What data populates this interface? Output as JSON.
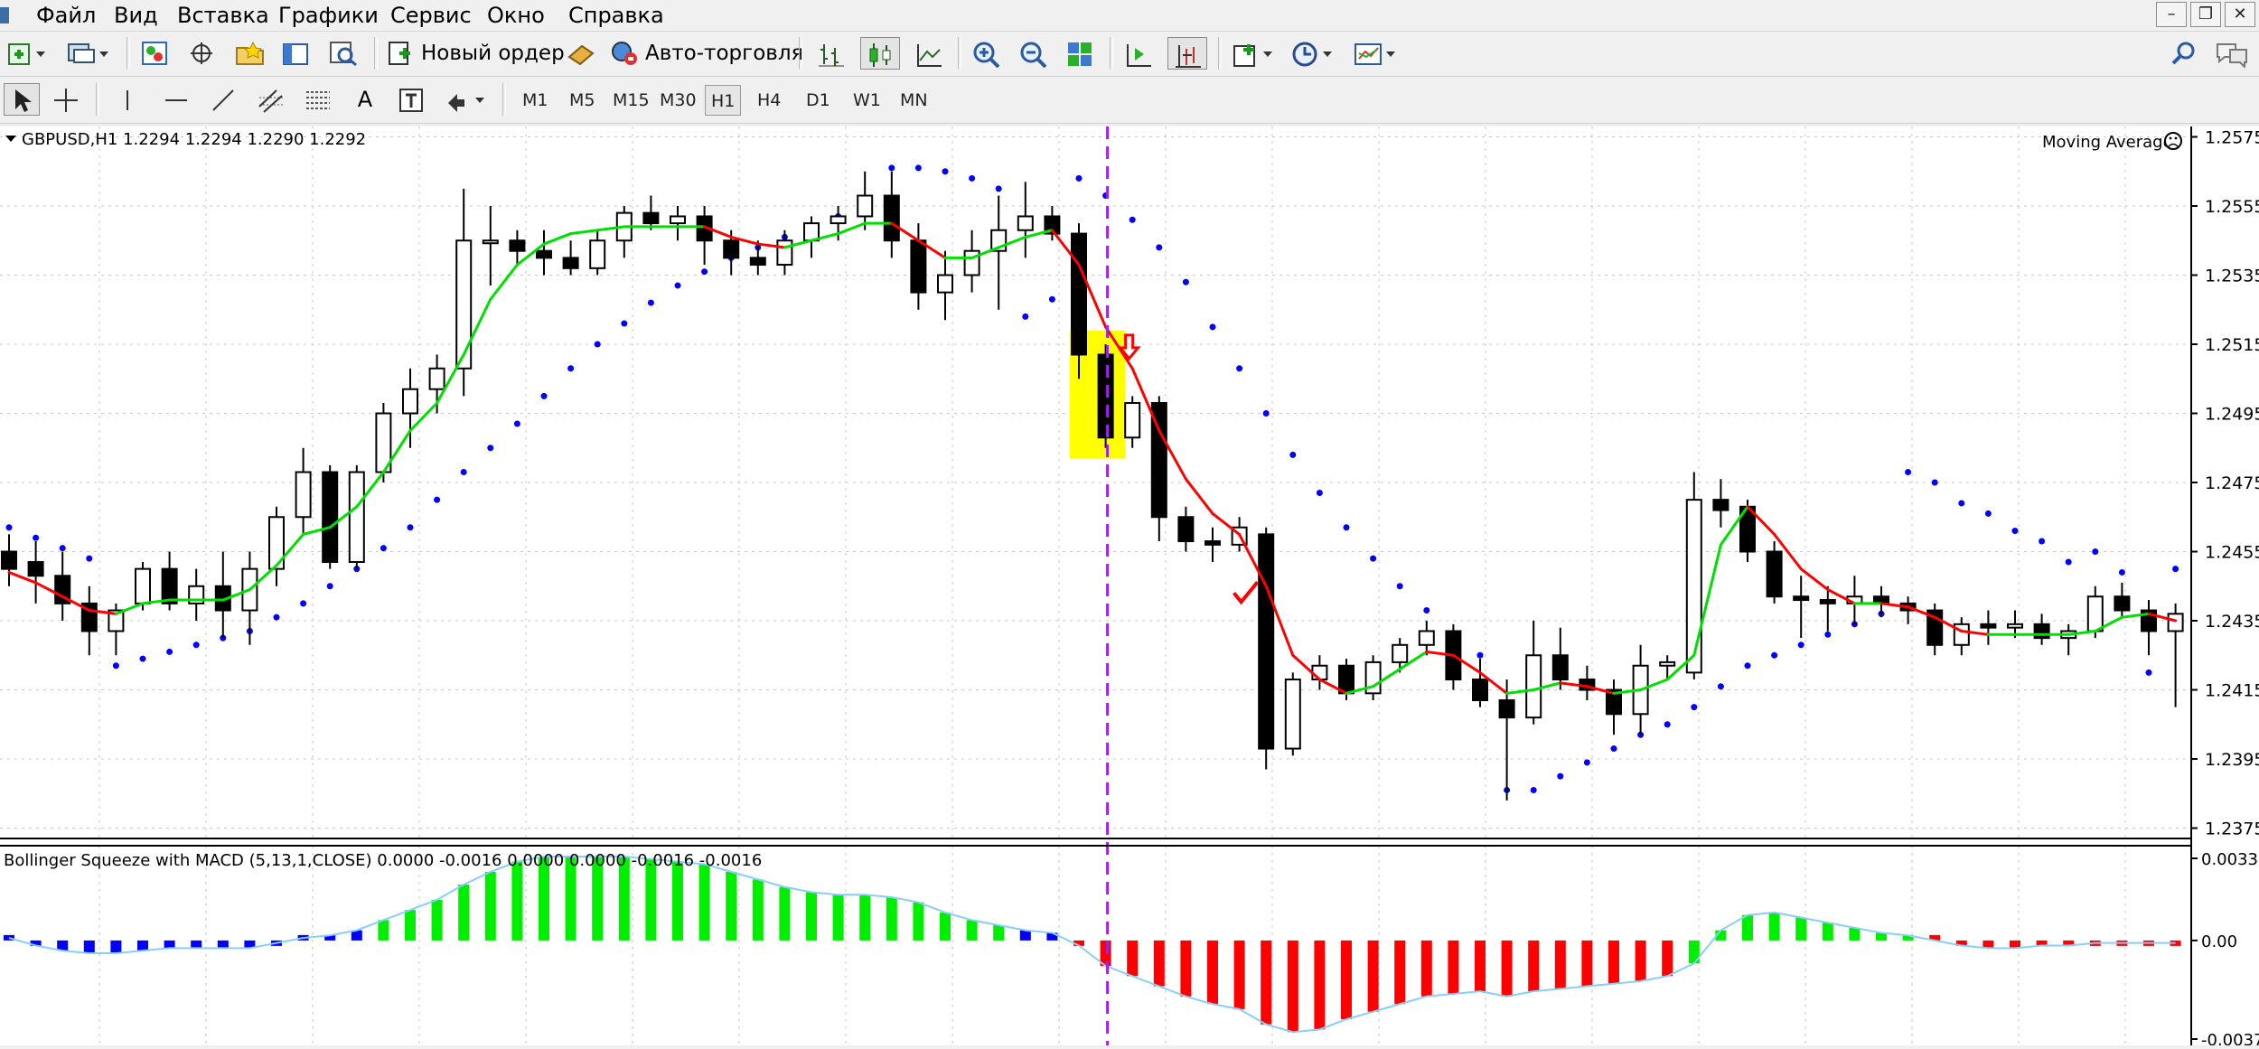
{
  "menu": [
    "Файл",
    "Вид",
    "Вставка",
    "Графики",
    "Сервис",
    "Окно",
    "Справка"
  ],
  "toolbar": {
    "new_order": "Новый ордер",
    "auto_trading": "Авто-торговля"
  },
  "timeframes": [
    "M1",
    "M5",
    "M15",
    "M30",
    "H1",
    "H4",
    "D1",
    "W1",
    "MN"
  ],
  "active_timeframe": "H1",
  "chart": {
    "header": "GBPUSD,H1  1.2294 1.2294 1.2290 1.2292",
    "indicator_name": "Moving Average",
    "price_labels": [
      "1.2575",
      "1.2555",
      "1.2535",
      "1.2515",
      "1.2495",
      "1.2475",
      "1.2455",
      "1.2435",
      "1.2415",
      "1.2395",
      "1.2375"
    ],
    "colors": {
      "ma_up": "#00e000",
      "ma_down": "#ff0000",
      "sar": "#0000ff",
      "vline": "#a020f0",
      "highlight": "#ffff00"
    }
  },
  "subwindow": {
    "header": "Bollinger Squeeze with MACD (5,13,1,CLOSE) 0.0000 -0.0016 0.0000 0.0000 -0.0016 -0.0016",
    "labels": [
      "0.0033",
      "0.00",
      "-0.0037"
    ],
    "colors": {
      "pos": "#00ee00",
      "neg": "#ff0000",
      "squeeze": "#0000ff",
      "line": "#87cefa"
    }
  },
  "chart_data": {
    "type": "candlestick",
    "symbol": "GBPUSD",
    "timeframe": "H1",
    "ylim": [
      1.2372,
      1.2578
    ],
    "candles": [
      [
        1.2455,
        1.246,
        1.2445,
        1.245
      ],
      [
        1.2452,
        1.2458,
        1.244,
        1.2448
      ],
      [
        1.2448,
        1.2455,
        1.2435,
        1.244
      ],
      [
        1.244,
        1.2445,
        1.2425,
        1.2432
      ],
      [
        1.2432,
        1.244,
        1.2425,
        1.2438
      ],
      [
        1.244,
        1.2452,
        1.2438,
        1.245
      ],
      [
        1.245,
        1.2455,
        1.2438,
        1.244
      ],
      [
        1.244,
        1.245,
        1.2435,
        1.2445
      ],
      [
        1.2445,
        1.2455,
        1.243,
        1.2438
      ],
      [
        1.2438,
        1.2455,
        1.2428,
        1.245
      ],
      [
        1.245,
        1.2468,
        1.2445,
        1.2465
      ],
      [
        1.2465,
        1.2485,
        1.246,
        1.2478
      ],
      [
        1.2478,
        1.248,
        1.245,
        1.2452
      ],
      [
        1.2452,
        1.248,
        1.245,
        1.2478
      ],
      [
        1.2478,
        1.2498,
        1.2475,
        1.2495
      ],
      [
        1.2495,
        1.2508,
        1.2485,
        1.2502
      ],
      [
        1.2502,
        1.2512,
        1.2495,
        1.2508
      ],
      [
        1.2508,
        1.256,
        1.25,
        1.2545
      ],
      [
        1.2545,
        1.2555,
        1.2532,
        1.2545
      ],
      [
        1.2545,
        1.2548,
        1.2538,
        1.2542
      ],
      [
        1.2542,
        1.2548,
        1.2535,
        1.254
      ],
      [
        1.254,
        1.2545,
        1.2535,
        1.2537
      ],
      [
        1.2537,
        1.2548,
        1.2535,
        1.2545
      ],
      [
        1.2545,
        1.2555,
        1.254,
        1.2553
      ],
      [
        1.2553,
        1.2558,
        1.2548,
        1.255
      ],
      [
        1.255,
        1.2555,
        1.2545,
        1.2552
      ],
      [
        1.2552,
        1.2555,
        1.2538,
        1.2545
      ],
      [
        1.2545,
        1.2548,
        1.2535,
        1.254
      ],
      [
        1.254,
        1.2545,
        1.2535,
        1.2538
      ],
      [
        1.2538,
        1.2548,
        1.2535,
        1.2545
      ],
      [
        1.2545,
        1.2552,
        1.254,
        1.255
      ],
      [
        1.255,
        1.2555,
        1.2545,
        1.2552
      ],
      [
        1.2552,
        1.2565,
        1.2548,
        1.2558
      ],
      [
        1.2558,
        1.2565,
        1.254,
        1.2545
      ],
      [
        1.2545,
        1.255,
        1.2525,
        1.253
      ],
      [
        1.253,
        1.2542,
        1.2522,
        1.2535
      ],
      [
        1.2535,
        1.2548,
        1.253,
        1.2542
      ],
      [
        1.2542,
        1.2558,
        1.2525,
        1.2548
      ],
      [
        1.2548,
        1.2562,
        1.254,
        1.2552
      ],
      [
        1.2552,
        1.2555,
        1.2545,
        1.2547
      ],
      [
        1.2547,
        1.255,
        1.2505,
        1.2512
      ],
      [
        1.2512,
        1.2515,
        1.2485,
        1.2488
      ],
      [
        1.2488,
        1.25,
        1.2485,
        1.2498
      ],
      [
        1.2498,
        1.25,
        1.2458,
        1.2465
      ],
      [
        1.2465,
        1.2468,
        1.2455,
        1.2458
      ],
      [
        1.2458,
        1.2462,
        1.2452,
        1.2457
      ],
      [
        1.2457,
        1.2465,
        1.2455,
        1.2462
      ],
      [
        1.246,
        1.2462,
        1.2392,
        1.2398
      ],
      [
        1.2398,
        1.242,
        1.2396,
        1.2418
      ],
      [
        1.2418,
        1.2425,
        1.2415,
        1.2422
      ],
      [
        1.2422,
        1.2424,
        1.2412,
        1.2414
      ],
      [
        1.2414,
        1.2425,
        1.2412,
        1.2423
      ],
      [
        1.2423,
        1.243,
        1.242,
        1.2428
      ],
      [
        1.2428,
        1.2435,
        1.2425,
        1.2432
      ],
      [
        1.2432,
        1.2434,
        1.2415,
        1.2418
      ],
      [
        1.2418,
        1.2424,
        1.241,
        1.2412
      ],
      [
        1.2412,
        1.2418,
        1.2383,
        1.2407
      ],
      [
        1.2407,
        1.2435,
        1.2405,
        1.2425
      ],
      [
        1.2425,
        1.2433,
        1.2415,
        1.2418
      ],
      [
        1.2418,
        1.2422,
        1.2412,
        1.2415
      ],
      [
        1.2415,
        1.2418,
        1.2402,
        1.2408
      ],
      [
        1.2408,
        1.2428,
        1.2402,
        1.2422
      ],
      [
        1.2422,
        1.2425,
        1.2418,
        1.2423
      ],
      [
        1.242,
        1.2478,
        1.2418,
        1.247
      ],
      [
        1.247,
        1.2476,
        1.2462,
        1.2467
      ],
      [
        1.2468,
        1.247,
        1.2452,
        1.2455
      ],
      [
        1.2455,
        1.2458,
        1.244,
        1.2442
      ],
      [
        1.2442,
        1.2448,
        1.243,
        1.2441
      ],
      [
        1.2441,
        1.2445,
        1.2432,
        1.244
      ],
      [
        1.244,
        1.2448,
        1.2434,
        1.2442
      ],
      [
        1.2442,
        1.2445,
        1.2436,
        1.244
      ],
      [
        1.244,
        1.2442,
        1.2434,
        1.2438
      ],
      [
        1.2438,
        1.244,
        1.2425,
        1.2428
      ],
      [
        1.2428,
        1.2436,
        1.2425,
        1.2434
      ],
      [
        1.2434,
        1.2438,
        1.2428,
        1.2433
      ],
      [
        1.2433,
        1.2438,
        1.243,
        1.2434
      ],
      [
        1.2434,
        1.2437,
        1.2428,
        1.243
      ],
      [
        1.243,
        1.2434,
        1.2425,
        1.2432
      ],
      [
        1.2432,
        1.2445,
        1.243,
        1.2442
      ],
      [
        1.2442,
        1.2446,
        1.2436,
        1.2438
      ],
      [
        1.2438,
        1.2441,
        1.2425,
        1.2432
      ],
      [
        1.2432,
        1.244,
        1.241,
        1.2437
      ]
    ],
    "ma": [
      1.2449,
      1.2446,
      1.2442,
      1.2438,
      1.2437,
      1.244,
      1.2441,
      1.2441,
      1.2441,
      1.2444,
      1.2451,
      1.246,
      1.2462,
      1.2468,
      1.2478,
      1.249,
      1.2498,
      1.2512,
      1.2528,
      1.2538,
      1.2544,
      1.2547,
      1.2548,
      1.2549,
      1.2549,
      1.2549,
      1.2549,
      1.2546,
      1.2544,
      1.2543,
      1.2545,
      1.2547,
      1.255,
      1.255,
      1.2545,
      1.254,
      1.254,
      1.2543,
      1.2546,
      1.2548,
      1.2538,
      1.252,
      1.2508,
      1.249,
      1.2476,
      1.2466,
      1.246,
      1.2445,
      1.2425,
      1.2418,
      1.2414,
      1.2416,
      1.2421,
      1.2426,
      1.2425,
      1.242,
      1.2414,
      1.2415,
      1.2417,
      1.2416,
      1.2414,
      1.2415,
      1.2418,
      1.2425,
      1.2457,
      1.2468,
      1.246,
      1.245,
      1.2444,
      1.244,
      1.244,
      1.2439,
      1.2436,
      1.2432,
      1.2431,
      1.2431,
      1.2431,
      1.2431,
      1.2432,
      1.2436,
      1.2437,
      1.2435
    ],
    "sar": [
      1.2462,
      1.2459,
      1.2456,
      1.2453,
      1.2422,
      1.2424,
      1.2426,
      1.2428,
      1.243,
      1.2432,
      1.2436,
      1.244,
      1.2445,
      1.245,
      1.2456,
      1.2462,
      1.247,
      1.2478,
      1.2485,
      1.2492,
      1.25,
      1.2508,
      1.2515,
      1.2521,
      1.2527,
      1.2532,
      1.2536,
      1.254,
      1.2543,
      1.2546,
      1.2549,
      1.2552,
      1.2555,
      1.2566,
      1.2566,
      1.2565,
      1.2563,
      1.256,
      1.2523,
      1.2528,
      1.2563,
      1.2558,
      1.2551,
      1.2543,
      1.2533,
      1.252,
      1.2508,
      1.2495,
      1.2483,
      1.2472,
      1.2462,
      1.2453,
      1.2445,
      1.2438,
      1.2431,
      1.2425,
      1.2386,
      1.2386,
      1.239,
      1.2394,
      1.2398,
      1.2402,
      1.2405,
      1.241,
      1.2416,
      1.2422,
      1.2425,
      1.2428,
      1.2431,
      1.2434,
      1.2437,
      1.2478,
      1.2475,
      1.2469,
      1.2466,
      1.2461,
      1.2458,
      1.2452,
      1.2455,
      1.2449,
      1.242,
      1.245
    ],
    "macd": [
      0.0001,
      -0.0002,
      -0.0004,
      -0.0005,
      -0.0005,
      -0.0004,
      -0.0003,
      -0.0003,
      -0.0003,
      -0.0003,
      -0.0001,
      0.0001,
      0.0002,
      0.0004,
      0.0008,
      0.0012,
      0.0016,
      0.0022,
      0.0027,
      0.0031,
      0.0033,
      0.0033,
      0.0033,
      0.0033,
      0.0032,
      0.0031,
      0.003,
      0.0027,
      0.0024,
      0.0021,
      0.0019,
      0.0018,
      0.0018,
      0.0017,
      0.0015,
      0.0011,
      0.0008,
      0.0006,
      0.0004,
      0.0003,
      -0.0002,
      -0.001,
      -0.0014,
      -0.0018,
      -0.0022,
      -0.0025,
      -0.0027,
      -0.0033,
      -0.0036,
      -0.0035,
      -0.0031,
      -0.0028,
      -0.0025,
      -0.0022,
      -0.0021,
      -0.002,
      -0.0022,
      -0.002,
      -0.0019,
      -0.0018,
      -0.0017,
      -0.0016,
      -0.0014,
      -0.0009,
      0.0004,
      0.001,
      0.0011,
      0.0009,
      0.0007,
      0.0005,
      0.0003,
      0.0002,
      0.0,
      -0.0002,
      -0.0003,
      -0.0003,
      -0.0002,
      -0.0002,
      -0.0001,
      -0.0001,
      -0.0001,
      -0.0001
    ],
    "sub_ylim": [
      -0.0037,
      0.0033
    ]
  }
}
